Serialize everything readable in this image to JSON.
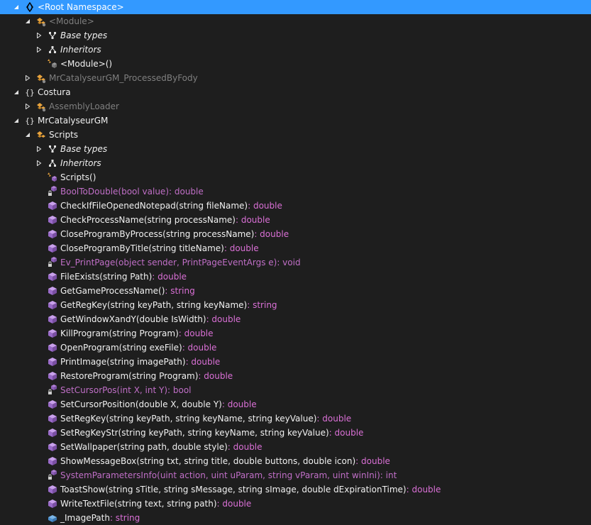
{
  "tree": {
    "root": {
      "label": "<Root Namespace>"
    },
    "module_class": {
      "label": "<Module>"
    },
    "module_base_types": {
      "label": "Base types"
    },
    "module_inheritors": {
      "label": "Inheritors"
    },
    "module_ctor": {
      "label": "<Module>()"
    },
    "processed_by_fody": {
      "label": "MrCatalyseurGM_ProcessedByFody"
    },
    "costura_ns": {
      "label": "Costura"
    },
    "assembly_loader": {
      "label": "AssemblyLoader"
    },
    "mrcat_ns": {
      "label": "MrCatalyseurGM"
    },
    "scripts_class": {
      "label": "Scripts"
    },
    "scripts_base_types": {
      "label": "Base types"
    },
    "scripts_inheritors": {
      "label": "Inheritors"
    },
    "scripts_ctor": {
      "label": "Scripts()"
    },
    "members": [
      {
        "sig": "BoolToDouble(bool value)",
        "ret": " : double",
        "private": true
      },
      {
        "sig": "CheckIfFileOpenedNotepad(string fileName)",
        "ret": " : double",
        "private": false
      },
      {
        "sig": "CheckProcessName(string processName)",
        "ret": " : double",
        "private": false
      },
      {
        "sig": "CloseProgramByProcess(string processName)",
        "ret": " : double",
        "private": false
      },
      {
        "sig": "CloseProgramByTitle(string titleName)",
        "ret": " : double",
        "private": false
      },
      {
        "sig": "Ev_PrintPage(object sender, PrintPageEventArgs e)",
        "ret": " : void",
        "private": true
      },
      {
        "sig": "FileExists(string Path)",
        "ret": " : double",
        "private": false
      },
      {
        "sig": "GetGameProcessName()",
        "ret": " : string",
        "private": false
      },
      {
        "sig": "GetRegKey(string keyPath, string keyName)",
        "ret": " : string",
        "private": false
      },
      {
        "sig": "GetWindowXandY(double IsWidth)",
        "ret": " : double",
        "private": false
      },
      {
        "sig": "KillProgram(string Program)",
        "ret": " : double",
        "private": false
      },
      {
        "sig": "OpenProgram(string exeFile)",
        "ret": " : double",
        "private": false
      },
      {
        "sig": "PrintImage(string imagePath)",
        "ret": " : double",
        "private": false
      },
      {
        "sig": "RestoreProgram(string Program)",
        "ret": " : double",
        "private": false
      },
      {
        "sig": "SetCursorPos(int X, int Y)",
        "ret": " : bool",
        "private": true
      },
      {
        "sig": "SetCursorPosition(double X, double Y)",
        "ret": " : double",
        "private": false
      },
      {
        "sig": "SetRegKey(string keyPath, string keyName, string keyValue)",
        "ret": " : double",
        "private": false
      },
      {
        "sig": "SetRegKeyStr(string keyPath, string keyName, string keyValue)",
        "ret": " : double",
        "private": false
      },
      {
        "sig": "SetWallpaper(string path, double style)",
        "ret": " : double",
        "private": false
      },
      {
        "sig": "ShowMessageBox(string txt, string title, double buttons, double icon)",
        "ret": " : double",
        "private": false
      },
      {
        "sig": "SystemParametersInfo(uint action, uint uParam, string vParam, uint winIni)",
        "ret": " : int",
        "private": true
      },
      {
        "sig": "ToastShow(string sTitle, string sMessage, string sImage, double dExpirationTime)",
        "ret": " : double",
        "private": false
      },
      {
        "sig": "WriteTextFile(string text, string path)",
        "ret": " : double",
        "private": false
      }
    ],
    "field": {
      "sig": "_ImagePath",
      "ret": " : string"
    }
  },
  "colors": {
    "background": "#1e1e1e",
    "selection": "#3399ff",
    "text": "#f1f1f1",
    "gray_text": "#7f7f7f",
    "return_type": "#da70d6",
    "private_member": "#c06fc7",
    "class_icon": "#e8a33d",
    "method_icon": "#b180d7"
  }
}
